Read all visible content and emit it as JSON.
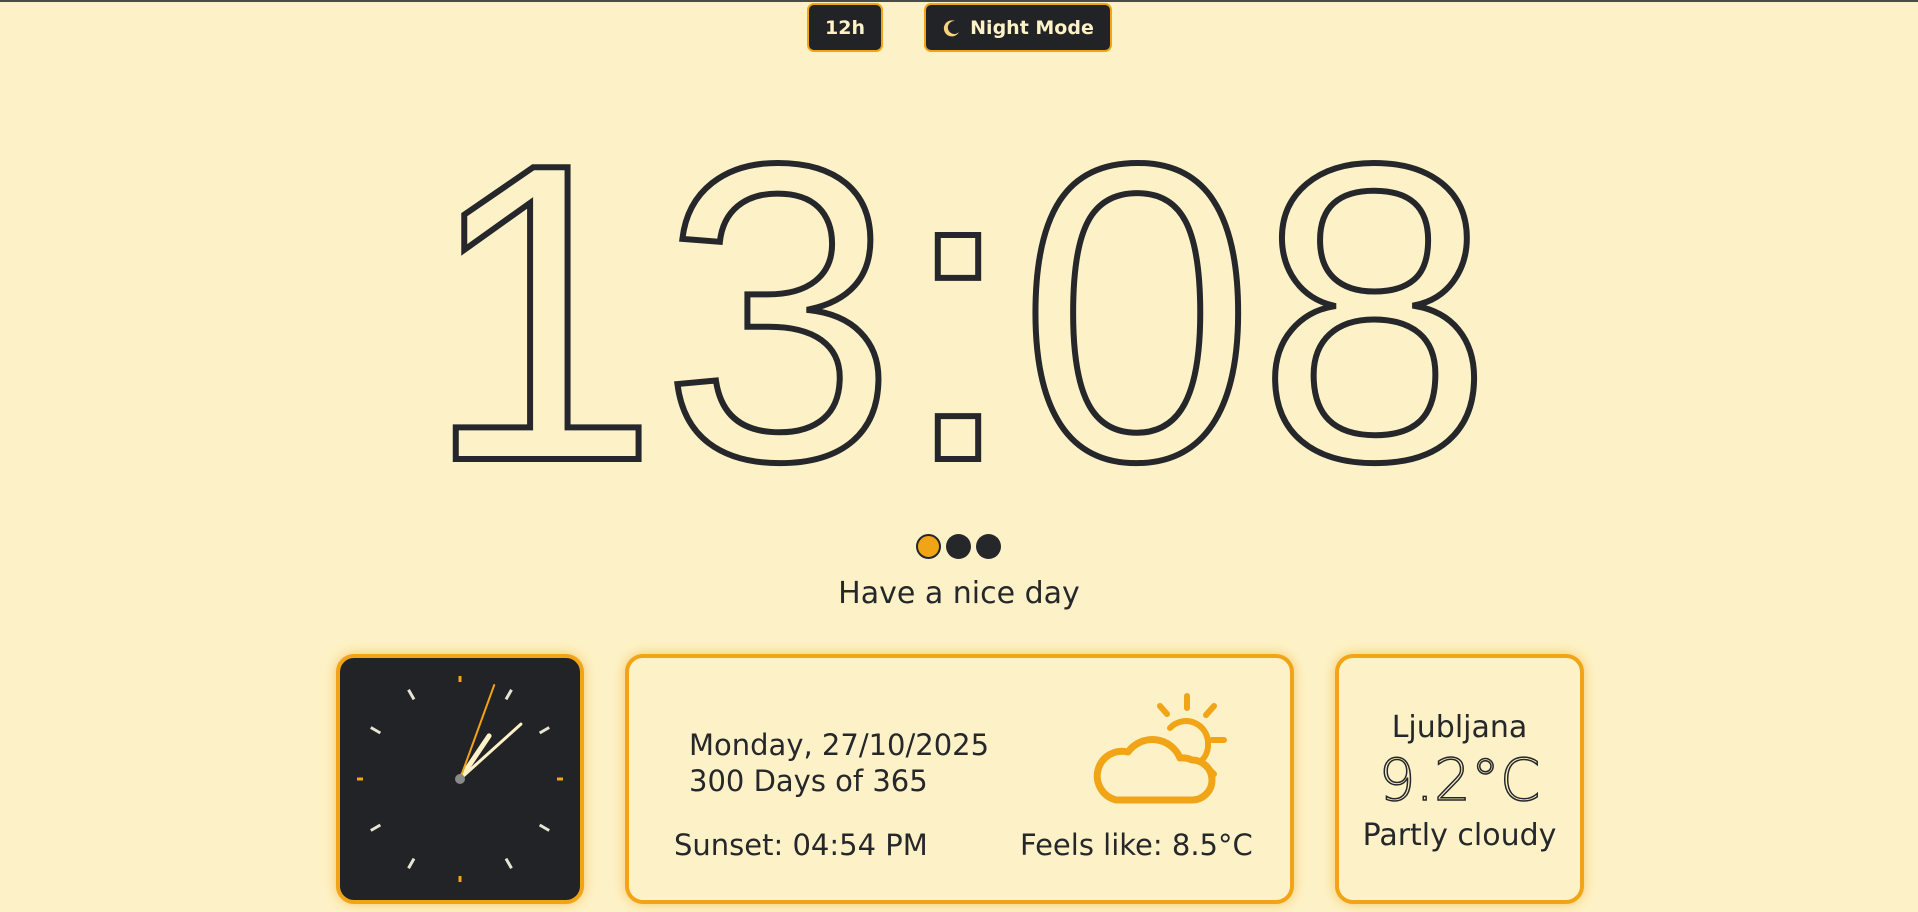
{
  "toolbar": {
    "format_label": "12h",
    "night_mode_label": "Night Mode",
    "night_mode_icon": "moon-icon"
  },
  "clock": {
    "time": "13:08",
    "analog_hour_deg": 34,
    "analog_minute_deg": 48,
    "analog_second_deg": 20
  },
  "pager": {
    "count": 3,
    "active_index": 0
  },
  "greeting": "Have a nice day",
  "date_card": {
    "date": "Monday, 27/10/2025",
    "day_of_year": "300 Days of 365",
    "sunset": "Sunset: 04:54 PM",
    "feels_like": "Feels like: 8.5°C",
    "weather_icon": "partly-cloudy-icon"
  },
  "city_card": {
    "city": "Ljubljana",
    "temperature": "9.2°C",
    "condition": "Partly cloudy"
  },
  "colors": {
    "background": "#fdf2c7",
    "accent": "#f2a417",
    "dark": "#222326",
    "text": "#25272b"
  }
}
